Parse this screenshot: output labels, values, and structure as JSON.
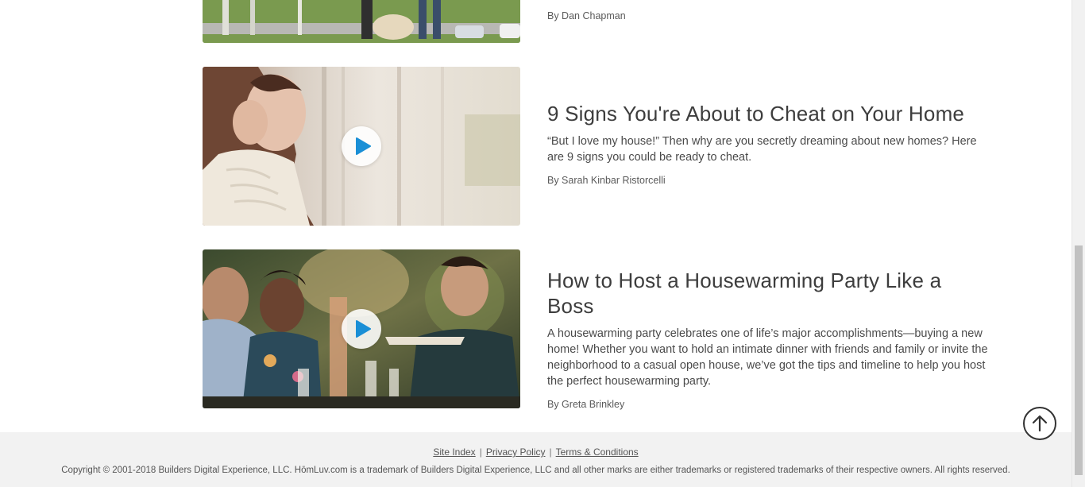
{
  "articles": [
    {
      "title": "",
      "description": "",
      "byline": "By Dan Chapman",
      "thumb_icon": "photo-thumbnail"
    },
    {
      "title": "9 Signs You're About to Cheat on Your Home",
      "description": "“But I love my house!” Then why are you secretly dreaming about new homes? Here are 9 signs you could be ready to cheat.",
      "byline": "By Sarah Kinbar Ristorcelli",
      "thumb_icon": "video-thumbnail"
    },
    {
      "title": "How to Host a Housewarming Party Like a Boss",
      "description": "A housewarming party celebrates one of life’s major accomplishments—buying a new home! Whether you want to hold an intimate dinner with friends and family or invite the neighborhood to a casual open house, we’ve got the tips and timeline to help you host the perfect housewarming party.",
      "byline": "By Greta Brinkley",
      "thumb_icon": "video-thumbnail"
    }
  ],
  "footer": {
    "links": [
      "Site Index",
      "Privacy Policy",
      "Terms & Conditions"
    ],
    "separator": "|",
    "copyright": "Copyright © 2001-2018 Builders Digital Experience, LLC. HōmLuv.com is a trademark of Builders Digital Experience, LLC and all other marks are either trademarks or registered trademarks of their respective owners. All rights reserved."
  },
  "colors": {
    "play_icon": "#1a8fd6",
    "footer_bg": "#f2f2f2",
    "title_text": "#3d3d3d"
  },
  "icons": {
    "play": "play-icon",
    "back_to_top": "arrow-up-icon"
  }
}
